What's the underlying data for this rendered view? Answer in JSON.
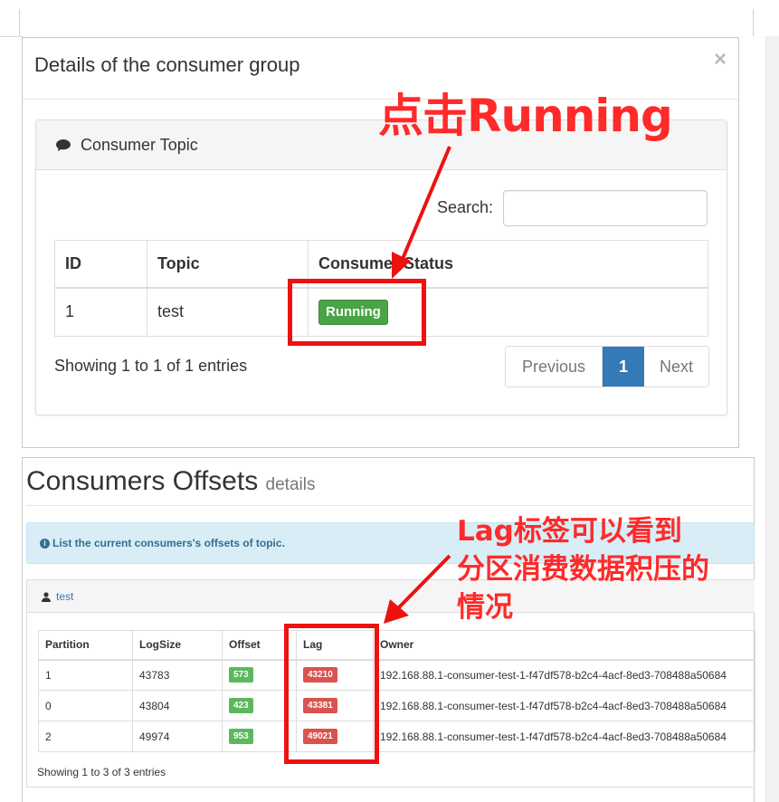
{
  "modal": {
    "title": "Details of the consumer group",
    "close_label": "×",
    "panel_title": "Consumer Topic",
    "search_label": "Search:",
    "search_value": "",
    "columns": [
      "ID",
      "Topic",
      "Consumer Status"
    ],
    "rows": [
      {
        "id": "1",
        "topic": "test",
        "status": "Running"
      }
    ],
    "showing": "Showing 1 to 1 of 1 entries",
    "pagination": {
      "previous": "Previous",
      "current": "1",
      "next": "Next"
    }
  },
  "offsets": {
    "title": "Consumers Offsets",
    "subtitle": "details",
    "info": "List the current consumers's offsets of topic.",
    "panel_title": "test",
    "columns": [
      "Partition",
      "LogSize",
      "Offset",
      "Lag",
      "Owner"
    ],
    "rows": [
      {
        "partition": "1",
        "logsize": "43783",
        "offset": "573",
        "lag": "43210",
        "owner": "192.168.88.1-consumer-test-1-f47df578-b2c4-4acf-8ed3-708488a50684"
      },
      {
        "partition": "0",
        "logsize": "43804",
        "offset": "423",
        "lag": "43381",
        "owner": "192.168.88.1-consumer-test-1-f47df578-b2c4-4acf-8ed3-708488a50684"
      },
      {
        "partition": "2",
        "logsize": "49974",
        "offset": "953",
        "lag": "49021",
        "owner": "192.168.88.1-consumer-test-1-f47df578-b2c4-4acf-8ed3-708488a50684"
      }
    ],
    "showing": "Showing 1 to 3 of 3 entries"
  },
  "annotations": {
    "running": "点击Running",
    "lag_line1": "Lag标签可以看到",
    "lag_line2": "分区消费数据积压的",
    "lag_line3": "情况"
  },
  "colors": {
    "accent": "#337ab7",
    "running": "#4aa346",
    "offset_badge": "#5cb85c",
    "lag_badge": "#d9534f",
    "annotation": "#ff2a2a"
  },
  "icons": {
    "panel_heading": "comment-icon",
    "info": "info-circle-icon",
    "topic_panel": "user-icon"
  }
}
